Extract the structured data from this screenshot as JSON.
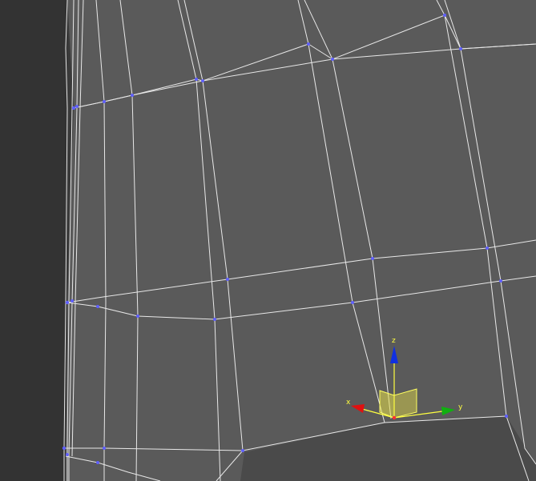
{
  "viewport": {
    "background_color": "#5a5a5a",
    "background_dark_color": "#333333",
    "wire_color": "#ffffff",
    "vertex_color": "#6060ff"
  },
  "gizmo": {
    "x_label": "x",
    "y_label": "y",
    "z_label": "z",
    "x_color": "#e01010",
    "y_color": "#10b010",
    "z_color": "#1030e0",
    "plane_color": "#e8e04a"
  }
}
